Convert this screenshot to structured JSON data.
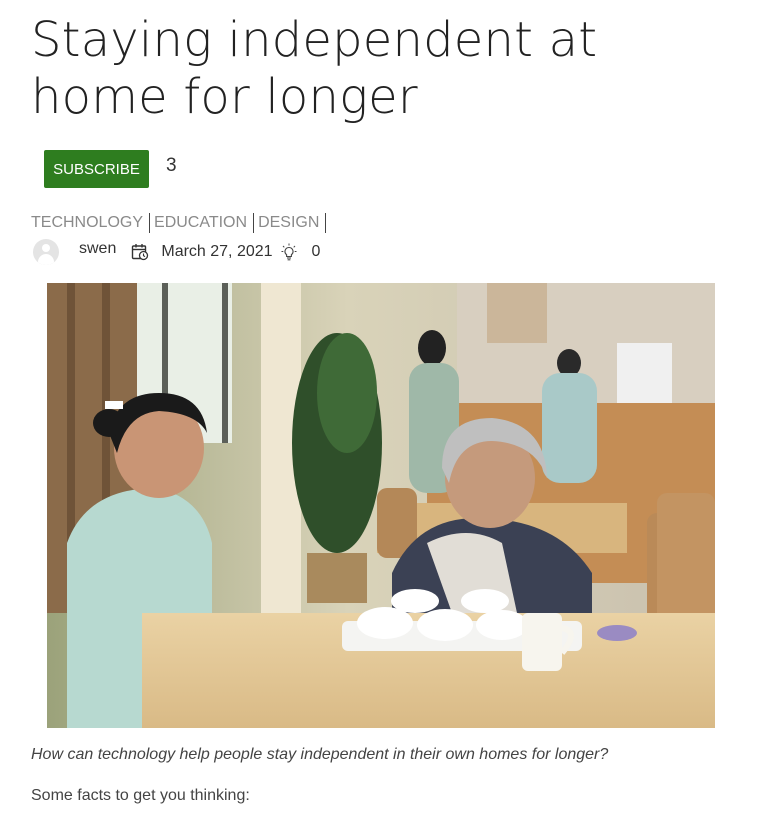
{
  "article": {
    "title": "Staying independent at home for longer",
    "subscribe_label": "SUBSCRIBE",
    "subscriber_count": "3",
    "categories": [
      "TECHNOLOGY",
      "EDUCATION",
      "DESIGN"
    ],
    "author": "swen",
    "date": "March 27, 2021",
    "view_count": "0",
    "intro": "How can technology help people stay independent in their own homes for longer?",
    "facts_lead": "Some facts to get you thinking:"
  },
  "colors": {
    "subscribe_bg": "#2e7d1f",
    "category_text": "#8a8a8a"
  },
  "icons": {
    "avatar": "avatar-icon",
    "date": "calendar-icon",
    "views": "lightbulb-icon"
  }
}
